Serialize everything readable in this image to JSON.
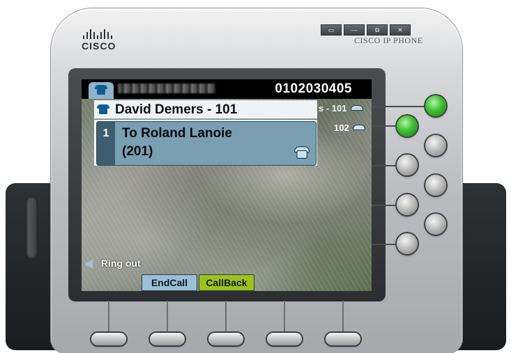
{
  "header": {
    "logo_text": "CISCO",
    "brand": "CISCO IP PHONE",
    "window_buttons": [
      "▭",
      "—",
      "⧉",
      "✕"
    ]
  },
  "screen": {
    "phone_number": "0102030405",
    "line_title": "David Demers - 101",
    "call": {
      "index": "1",
      "line1": "To Roland Lanoie",
      "line2": "(201)"
    },
    "side_lines": [
      "s - 101",
      "102"
    ],
    "status": "Ring out",
    "softkeys": [
      "EndCall",
      "CallBack"
    ]
  },
  "colors": {
    "accent": "#7a9fb3",
    "callback": "#9dc21a",
    "endcall": "#9bbfd6",
    "green_button": "#3fbf33"
  },
  "icons": [
    "phone-icon",
    "speaker-icon",
    "handset-icon"
  ]
}
